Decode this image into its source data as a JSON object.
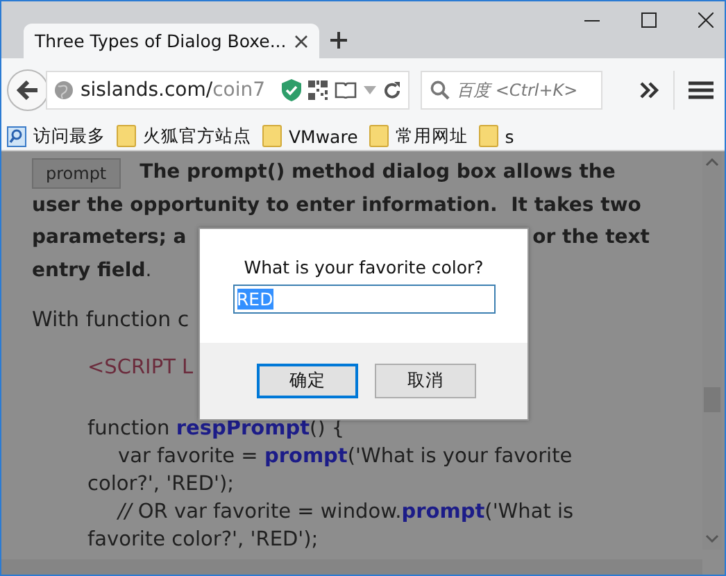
{
  "tab": {
    "title": "Three Types of Dialog Boxe..."
  },
  "address_bar": {
    "host": "sislands.com/",
    "path": "coin7"
  },
  "search": {
    "placeholder": "百度 <Ctrl+K>"
  },
  "bookmarks": [
    {
      "label": "访问最多",
      "kind": "smart"
    },
    {
      "label": "火狐官方站点",
      "kind": "folder"
    },
    {
      "label": "VMware",
      "kind": "folder"
    },
    {
      "label": "常用网址",
      "kind": "folder"
    },
    {
      "label": "s",
      "kind": "folder"
    }
  ],
  "page": {
    "button": "prompt",
    "paragraph_lines": [
      {
        "parts": [
          "**The prompt() method dialog box allows the**"
        ]
      },
      {
        "parts": [
          "**user the opportunity to enter information.  It takes two**"
        ]
      },
      {
        "parts": [
          "**parameters; a**",
          "**or the text**"
        ]
      },
      {
        "parts": [
          "**entry field**."
        ]
      }
    ],
    "intro": "With function c",
    "code_lines": [
      {
        "kind": "tag",
        "text": "<SCRIPT L"
      },
      {
        "kind": "plain",
        "text": "function **respPrompt**() {"
      },
      {
        "kind": "indented",
        "text": "var favorite = **prompt**('What is your favorite"
      },
      {
        "kind": "plain",
        "text": "color?', 'RED');"
      },
      {
        "kind": "indented",
        "text": "*//* OR var favorite = window.**prompt**('What is"
      },
      {
        "kind": "plain",
        "text": "favorite color?', 'RED');"
      }
    ]
  },
  "dialog": {
    "message": "What is your favorite color?",
    "value": "RED",
    "buttons": [
      {
        "label": "确定",
        "default": true
      },
      {
        "label": "取消",
        "default": false
      }
    ]
  }
}
